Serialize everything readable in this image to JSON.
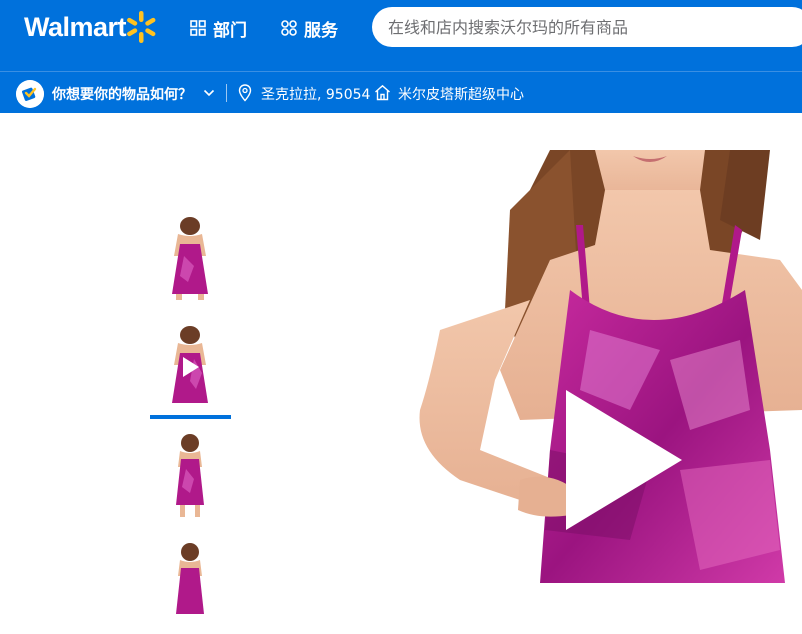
{
  "header": {
    "logo_text": "Walmart",
    "departments_label": "部门",
    "services_label": "服务",
    "search_placeholder": "在线和店内搜索沃尔玛的所有商品"
  },
  "subheader": {
    "delivery_question": "你想要你的物品如何？",
    "location": "圣克拉拉, 95054",
    "store": "米尔皮塔斯超级中心"
  },
  "gallery": {
    "thumbnails": [
      {
        "kind": "image",
        "selected": false
      },
      {
        "kind": "video",
        "selected": true
      },
      {
        "kind": "image",
        "selected": false
      },
      {
        "kind": "image",
        "selected": false
      }
    ],
    "main_media": "video"
  },
  "colors": {
    "brand_blue": "#0071dc",
    "spark_yellow": "#ffc220",
    "dress_magenta": "#b0198a"
  }
}
